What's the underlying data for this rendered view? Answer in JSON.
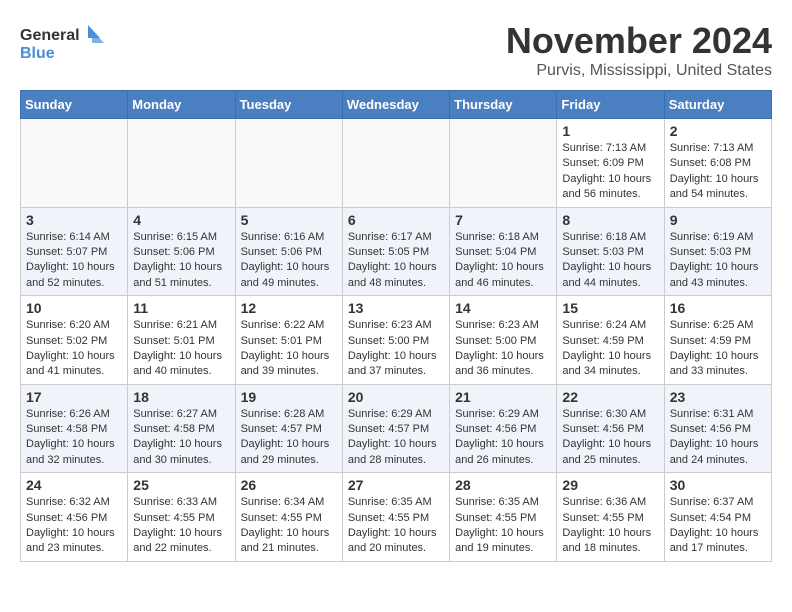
{
  "header": {
    "logo_general": "General",
    "logo_blue": "Blue",
    "month_year": "November 2024",
    "location": "Purvis, Mississippi, United States"
  },
  "days_of_week": [
    "Sunday",
    "Monday",
    "Tuesday",
    "Wednesday",
    "Thursday",
    "Friday",
    "Saturday"
  ],
  "weeks": [
    {
      "days": [
        {
          "num": "",
          "info": ""
        },
        {
          "num": "",
          "info": ""
        },
        {
          "num": "",
          "info": ""
        },
        {
          "num": "",
          "info": ""
        },
        {
          "num": "",
          "info": ""
        },
        {
          "num": "1",
          "info": "Sunrise: 7:13 AM\nSunset: 6:09 PM\nDaylight: 10 hours and 56 minutes."
        },
        {
          "num": "2",
          "info": "Sunrise: 7:13 AM\nSunset: 6:08 PM\nDaylight: 10 hours and 54 minutes."
        }
      ]
    },
    {
      "days": [
        {
          "num": "3",
          "info": "Sunrise: 6:14 AM\nSunset: 5:07 PM\nDaylight: 10 hours and 52 minutes."
        },
        {
          "num": "4",
          "info": "Sunrise: 6:15 AM\nSunset: 5:06 PM\nDaylight: 10 hours and 51 minutes."
        },
        {
          "num": "5",
          "info": "Sunrise: 6:16 AM\nSunset: 5:06 PM\nDaylight: 10 hours and 49 minutes."
        },
        {
          "num": "6",
          "info": "Sunrise: 6:17 AM\nSunset: 5:05 PM\nDaylight: 10 hours and 48 minutes."
        },
        {
          "num": "7",
          "info": "Sunrise: 6:18 AM\nSunset: 5:04 PM\nDaylight: 10 hours and 46 minutes."
        },
        {
          "num": "8",
          "info": "Sunrise: 6:18 AM\nSunset: 5:03 PM\nDaylight: 10 hours and 44 minutes."
        },
        {
          "num": "9",
          "info": "Sunrise: 6:19 AM\nSunset: 5:03 PM\nDaylight: 10 hours and 43 minutes."
        }
      ]
    },
    {
      "days": [
        {
          "num": "10",
          "info": "Sunrise: 6:20 AM\nSunset: 5:02 PM\nDaylight: 10 hours and 41 minutes."
        },
        {
          "num": "11",
          "info": "Sunrise: 6:21 AM\nSunset: 5:01 PM\nDaylight: 10 hours and 40 minutes."
        },
        {
          "num": "12",
          "info": "Sunrise: 6:22 AM\nSunset: 5:01 PM\nDaylight: 10 hours and 39 minutes."
        },
        {
          "num": "13",
          "info": "Sunrise: 6:23 AM\nSunset: 5:00 PM\nDaylight: 10 hours and 37 minutes."
        },
        {
          "num": "14",
          "info": "Sunrise: 6:23 AM\nSunset: 5:00 PM\nDaylight: 10 hours and 36 minutes."
        },
        {
          "num": "15",
          "info": "Sunrise: 6:24 AM\nSunset: 4:59 PM\nDaylight: 10 hours and 34 minutes."
        },
        {
          "num": "16",
          "info": "Sunrise: 6:25 AM\nSunset: 4:59 PM\nDaylight: 10 hours and 33 minutes."
        }
      ]
    },
    {
      "days": [
        {
          "num": "17",
          "info": "Sunrise: 6:26 AM\nSunset: 4:58 PM\nDaylight: 10 hours and 32 minutes."
        },
        {
          "num": "18",
          "info": "Sunrise: 6:27 AM\nSunset: 4:58 PM\nDaylight: 10 hours and 30 minutes."
        },
        {
          "num": "19",
          "info": "Sunrise: 6:28 AM\nSunset: 4:57 PM\nDaylight: 10 hours and 29 minutes."
        },
        {
          "num": "20",
          "info": "Sunrise: 6:29 AM\nSunset: 4:57 PM\nDaylight: 10 hours and 28 minutes."
        },
        {
          "num": "21",
          "info": "Sunrise: 6:29 AM\nSunset: 4:56 PM\nDaylight: 10 hours and 26 minutes."
        },
        {
          "num": "22",
          "info": "Sunrise: 6:30 AM\nSunset: 4:56 PM\nDaylight: 10 hours and 25 minutes."
        },
        {
          "num": "23",
          "info": "Sunrise: 6:31 AM\nSunset: 4:56 PM\nDaylight: 10 hours and 24 minutes."
        }
      ]
    },
    {
      "days": [
        {
          "num": "24",
          "info": "Sunrise: 6:32 AM\nSunset: 4:56 PM\nDaylight: 10 hours and 23 minutes."
        },
        {
          "num": "25",
          "info": "Sunrise: 6:33 AM\nSunset: 4:55 PM\nDaylight: 10 hours and 22 minutes."
        },
        {
          "num": "26",
          "info": "Sunrise: 6:34 AM\nSunset: 4:55 PM\nDaylight: 10 hours and 21 minutes."
        },
        {
          "num": "27",
          "info": "Sunrise: 6:35 AM\nSunset: 4:55 PM\nDaylight: 10 hours and 20 minutes."
        },
        {
          "num": "28",
          "info": "Sunrise: 6:35 AM\nSunset: 4:55 PM\nDaylight: 10 hours and 19 minutes."
        },
        {
          "num": "29",
          "info": "Sunrise: 6:36 AM\nSunset: 4:55 PM\nDaylight: 10 hours and 18 minutes."
        },
        {
          "num": "30",
          "info": "Sunrise: 6:37 AM\nSunset: 4:54 PM\nDaylight: 10 hours and 17 minutes."
        }
      ]
    }
  ]
}
